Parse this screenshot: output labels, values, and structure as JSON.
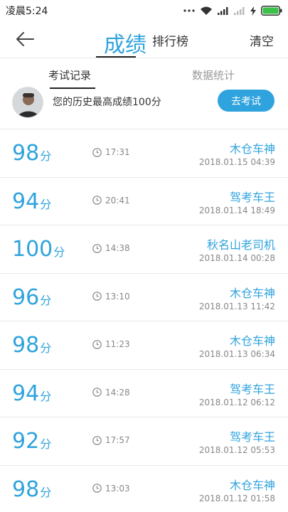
{
  "status": {
    "time": "凌晨5:24",
    "icons": [
      "more-dots-icon",
      "wifi-icon",
      "signal-icon",
      "signal-weak-icon",
      "charging-icon",
      "battery-icon"
    ]
  },
  "nav": {
    "back_icon": "back-arrow-icon",
    "tabs": [
      {
        "label": "成绩"
      },
      {
        "label": "排行榜"
      }
    ],
    "clear_label": "清空"
  },
  "sub_tabs": [
    {
      "label": "考试记录"
    },
    {
      "label": "数据统计"
    }
  ],
  "best": {
    "text": "您的历史最高成绩100分",
    "button_label": "去考试"
  },
  "records": [
    {
      "score": "98",
      "unit": "分",
      "time": "17:31",
      "driver": "木仓车神",
      "date": "2018.01.15  04:39"
    },
    {
      "score": "94",
      "unit": "分",
      "time": "20:41",
      "driver": "驾考车王",
      "date": "2018.01.14  18:49"
    },
    {
      "score": "100",
      "unit": "分",
      "time": "14:38",
      "driver": "秋名山老司机",
      "date": "2018.01.14  00:28"
    },
    {
      "score": "96",
      "unit": "分",
      "time": "13:10",
      "driver": "木仓车神",
      "date": "2018.01.13  11:42"
    },
    {
      "score": "98",
      "unit": "分",
      "time": "11:23",
      "driver": "木仓车神",
      "date": "2018.01.13  06:34"
    },
    {
      "score": "94",
      "unit": "分",
      "time": "14:28",
      "driver": "驾考车王",
      "date": "2018.01.12  06:12"
    },
    {
      "score": "92",
      "unit": "分",
      "time": "17:57",
      "driver": "驾考车王",
      "date": "2018.01.12  05:53"
    },
    {
      "score": "98",
      "unit": "分",
      "time": "13:03",
      "driver": "木仓车神",
      "date": "2018.01.12  01:58"
    }
  ],
  "colors": {
    "accent": "#2fa3dd",
    "text": "#333333",
    "muted": "#888888",
    "divider": "#e8e8e8"
  }
}
